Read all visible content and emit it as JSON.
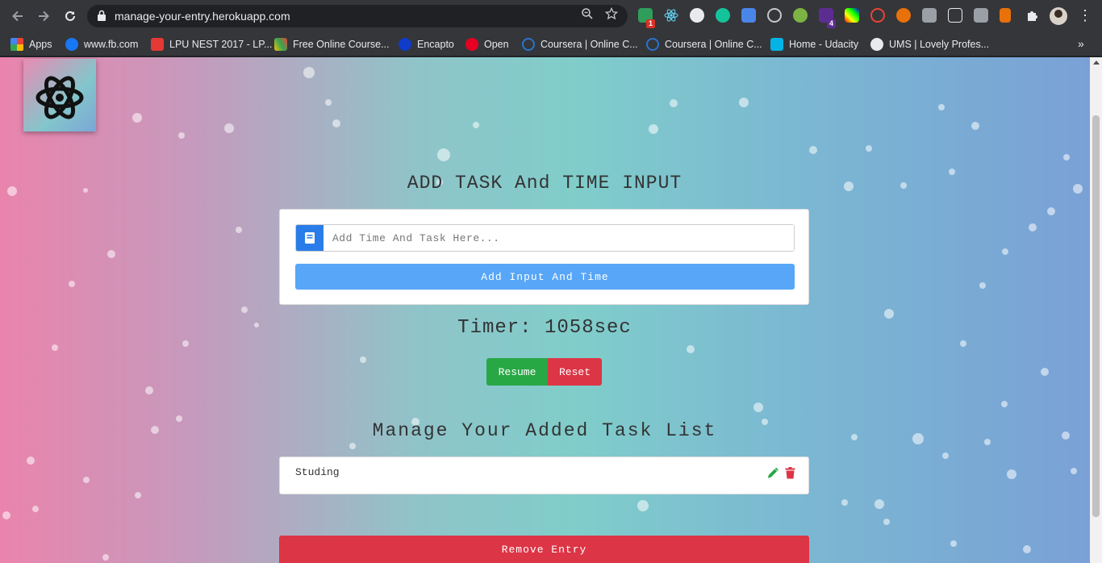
{
  "browser": {
    "url": "manage-your-entry.herokuapp.com",
    "nav_icons": [
      "back-arrow-icon",
      "forward-arrow-icon",
      "reload-icon"
    ],
    "extension_badges": [
      "1",
      "4"
    ],
    "bookmarks": [
      {
        "label": "Apps",
        "icon": "apps-grid-icon"
      },
      {
        "label": "www.fb.com",
        "icon": "facebook-icon"
      },
      {
        "label": "LPU NEST 2017 - LP...",
        "icon": "lpu-icon"
      },
      {
        "label": "Free Online Course...",
        "icon": "course-icon"
      },
      {
        "label": "Encapto",
        "icon": "jio-icon"
      },
      {
        "label": "Open",
        "icon": "pinterest-icon"
      },
      {
        "label": "Coursera | Online C...",
        "icon": "coursera-icon"
      },
      {
        "label": "Coursera | Online C...",
        "icon": "coursera-icon"
      },
      {
        "label": "Home - Udacity",
        "icon": "udacity-icon"
      },
      {
        "label": "UMS | Lovely Profes...",
        "icon": "globe-icon"
      }
    ],
    "bookmarks_more": "»"
  },
  "page": {
    "add_heading": "ADD TASK And TIME INPUT",
    "input_placeholder": "Add Time And Task Here...",
    "add_button": "Add Input And Time",
    "timer_text": "Timer: 1058sec",
    "resume_button": "Resume",
    "reset_button": "Reset",
    "manage_heading": "Manage Your Added Task List",
    "tasks": [
      {
        "text": "Studing"
      }
    ],
    "remove_button": "Remove Entry"
  },
  "colors": {
    "primary": "#2a7de9",
    "add_button": "#57a6f7",
    "success": "#28a745",
    "danger": "#dc3545"
  }
}
